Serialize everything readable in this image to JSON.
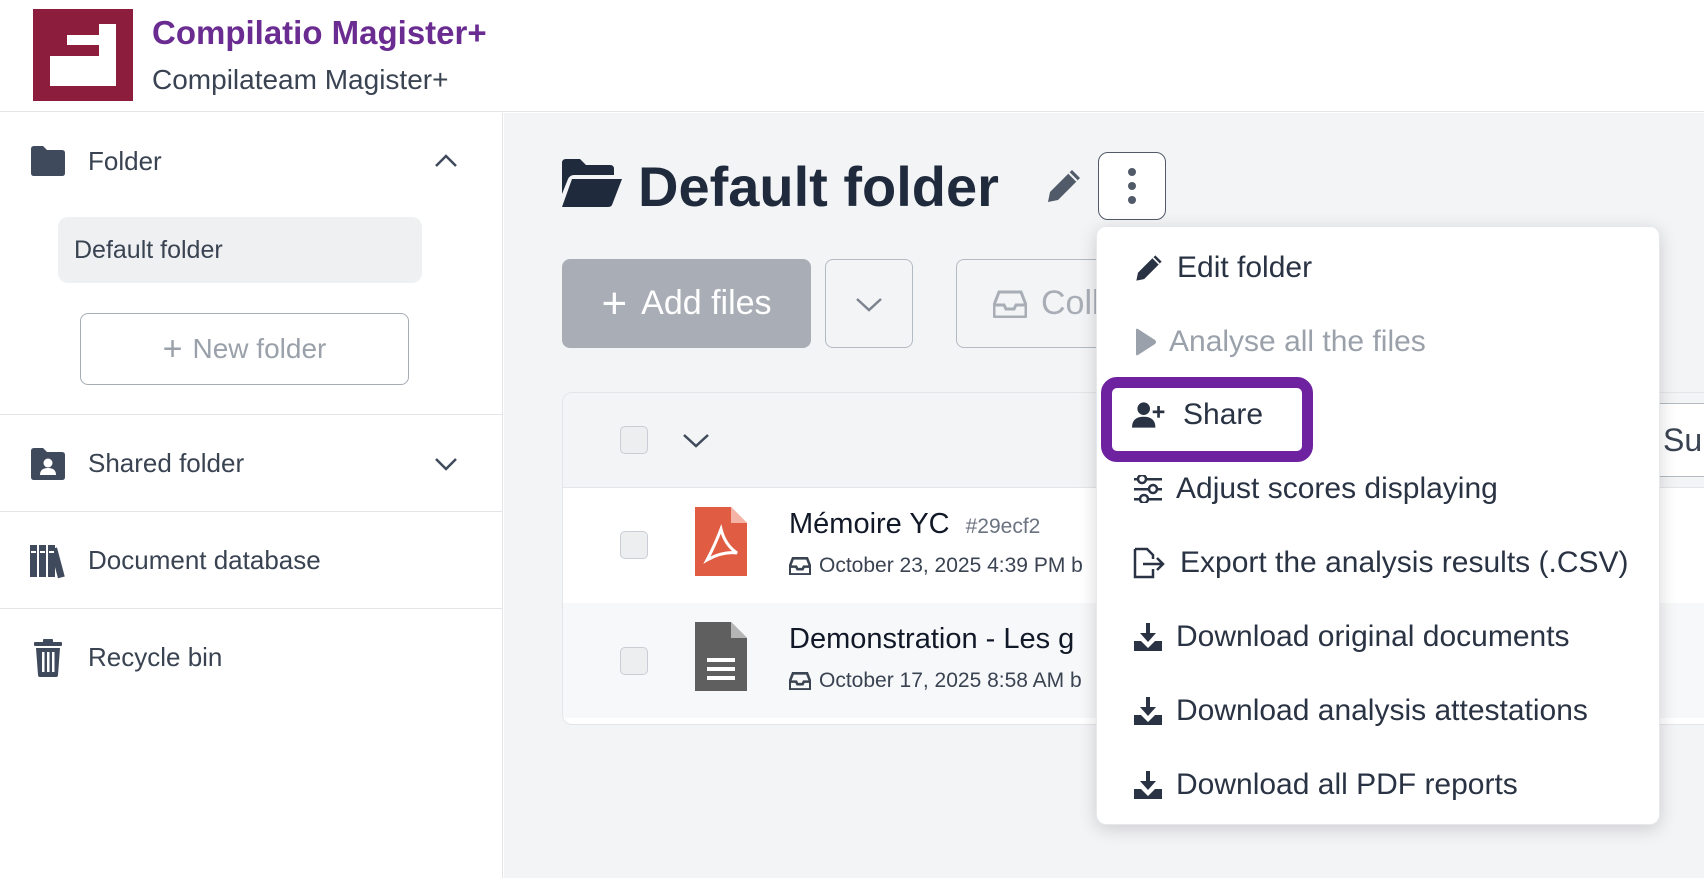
{
  "header": {
    "app_title": "Compilatio Magister+",
    "app_subtitle": "Compilateam Magister+",
    "brand_color": "#8c1d3c",
    "title_color": "#6a2c91"
  },
  "sidebar": {
    "folder_section": {
      "label": "Folder",
      "icon": "folder-icon",
      "expanded": true
    },
    "default_folder": "Default folder",
    "new_folder": "New folder",
    "shared_folder": {
      "label": "Shared folder",
      "icon": "shared-folder-icon",
      "expanded": false
    },
    "document_database": {
      "label": "Document database",
      "icon": "books-icon"
    },
    "recycle_bin": {
      "label": "Recycle bin",
      "icon": "trash-icon"
    }
  },
  "main": {
    "folder_title": "Default folder",
    "toolbar": {
      "add_files": "Add files",
      "collect": "Coll"
    },
    "table": {
      "header_extra": "Sub",
      "rows": [
        {
          "name": "Mémoire YC",
          "id": "#29ecf2",
          "date": "October 23, 2025 4:39 PM",
          "by": "b",
          "type": "pdf",
          "icon_color": "#e05d44"
        },
        {
          "name": "Demonstration - Les g",
          "id": "",
          "date": "October 17, 2025 8:58 AM",
          "by": "b",
          "type": "doc",
          "icon_color": "#5f5f5f"
        }
      ]
    }
  },
  "menu": {
    "items": [
      {
        "label": "Edit folder",
        "icon": "pencil-icon",
        "disabled": false
      },
      {
        "label": "Analyse all the files",
        "icon": "play-icon",
        "disabled": true
      },
      {
        "label": "Share",
        "icon": "user-plus-icon",
        "disabled": false,
        "highlighted": true
      },
      {
        "label": "Adjust scores displaying",
        "icon": "sliders-icon",
        "disabled": false
      },
      {
        "label": "Export the analysis results (.CSV)",
        "icon": "export-file-icon",
        "disabled": false
      },
      {
        "label": "Download original documents",
        "icon": "download-icon",
        "disabled": false
      },
      {
        "label": "Download analysis attestations",
        "icon": "download-icon",
        "disabled": false
      },
      {
        "label": "Download all PDF reports",
        "icon": "download-icon",
        "disabled": false
      }
    ],
    "highlight_color": "#6f22a0"
  }
}
